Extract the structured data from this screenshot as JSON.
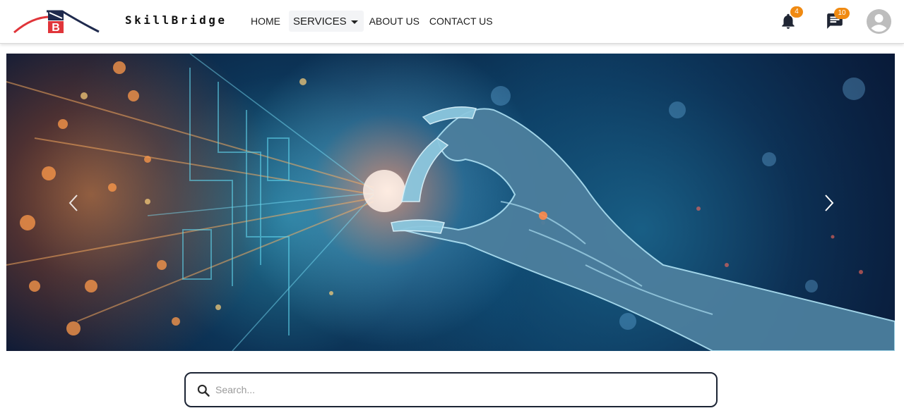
{
  "brand": {
    "name": "SkillBridge"
  },
  "nav": {
    "home": "HOME",
    "services": "SERVICES",
    "about": "ABOUT US",
    "contact": "CONTACT US"
  },
  "header_icons": {
    "notifications": {
      "icon": "bell-icon",
      "count": "4"
    },
    "messages": {
      "icon": "chat-icon",
      "count": "10"
    },
    "profile": {
      "icon": "user-avatar-icon"
    }
  },
  "hero": {
    "image": "robotic-hand-digital-background",
    "prev_icon": "chevron-left-icon",
    "next_icon": "chevron-right-icon"
  },
  "search": {
    "placeholder": "Search..."
  },
  "colors": {
    "badge": "#f08a12",
    "logo_red": "#e0353a",
    "logo_navy": "#1f2a4d",
    "search_border": "#1c2434"
  }
}
